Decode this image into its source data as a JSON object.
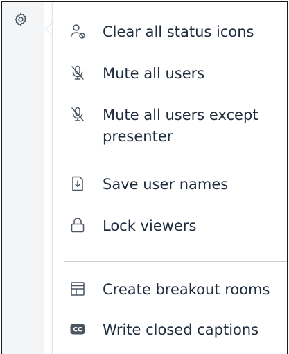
{
  "settings": {
    "gear_icon": "gear-icon"
  },
  "menu": {
    "items": [
      {
        "id": "clear-status",
        "label": "Clear all status icons",
        "icon": "user-clear-icon"
      },
      {
        "id": "mute-all",
        "label": "Mute all users",
        "icon": "mic-off-icon"
      },
      {
        "id": "mute-except",
        "label": "Mute all users except presenter",
        "icon": "mic-off-icon"
      },
      {
        "id": "save-names",
        "label": "Save user names",
        "icon": "download-file-icon"
      },
      {
        "id": "lock-viewers",
        "label": "Lock viewers",
        "icon": "lock-icon"
      },
      {
        "id": "breakout",
        "label": "Create breakout rooms",
        "icon": "breakout-rooms-icon"
      },
      {
        "id": "captions",
        "label": "Write closed captions",
        "icon": "closed-captions-icon"
      }
    ]
  },
  "colors": {
    "text": "#1f2d3d",
    "icon": "#4a5560",
    "rail": "#f3f5f7",
    "divider": "#c8ced6"
  }
}
